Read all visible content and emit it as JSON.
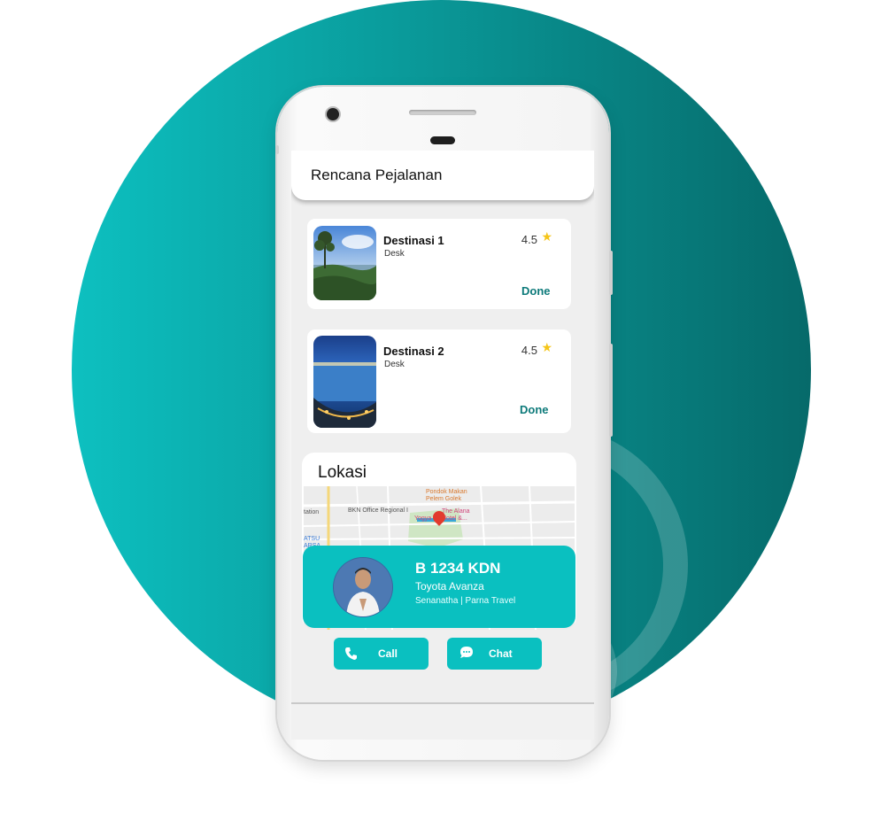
{
  "app": {
    "title": "Rencana Pejalanan"
  },
  "destinations": [
    {
      "name": "Destinasi 1",
      "desc": "Desk",
      "rating": "4.5",
      "status": "Done"
    },
    {
      "name": "Destinasi 2",
      "desc": "Desk",
      "rating": "4.5",
      "status": "Done"
    }
  ],
  "location": {
    "title": "Lokasi",
    "map_labels": [
      "Pondok Makan Pelem Golek",
      "BKN Office Regional I",
      "The Alana Hotel &...",
      "Yogya",
      "tation",
      "ATSU ARSA"
    ]
  },
  "driver": {
    "plate": "B 1234 KDN",
    "car": "Toyota Avanza",
    "agency": "Senanatha | Parna Travel"
  },
  "actions": {
    "call": "Call",
    "chat": "Chat"
  },
  "colors": {
    "accent": "#0ac0c0",
    "done": "#0d7a7a",
    "star": "#f5c518"
  },
  "icons": [
    "phone-icon",
    "chat-bubble-icon",
    "star-icon",
    "map-pin-icon"
  ]
}
